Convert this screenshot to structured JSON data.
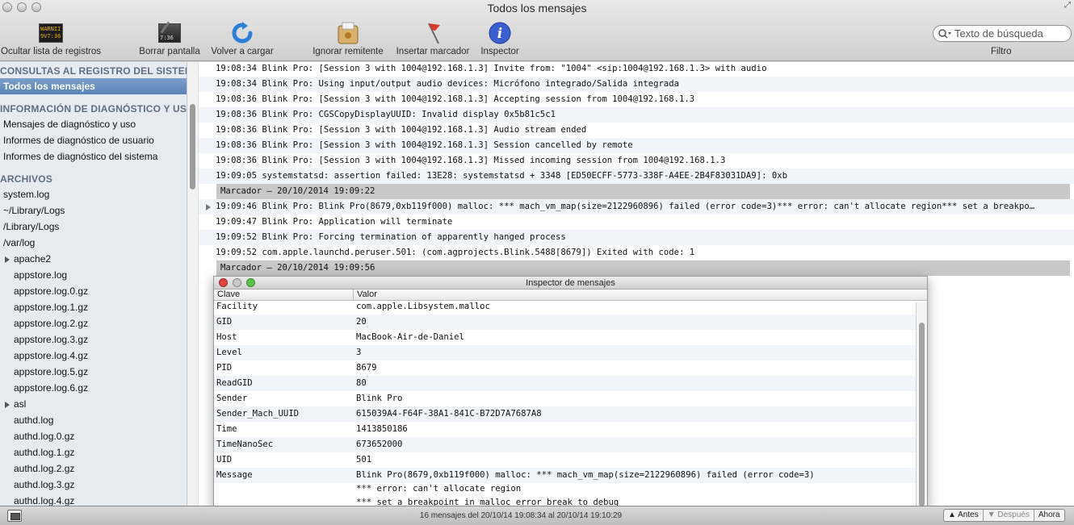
{
  "window": {
    "title": "Todos los mensajes"
  },
  "toolbar": {
    "items": [
      {
        "label": "Ocultar lista de registros",
        "icon": "console-icon",
        "icon_text": "WARNII\n9V7:36"
      },
      {
        "label": "Borrar pantalla",
        "icon": "clear-icon",
        "icon_text": "7:36"
      },
      {
        "label": "Volver a cargar",
        "icon": "reload-icon"
      },
      {
        "label": "Ignorar remitente",
        "icon": "ignore-icon"
      },
      {
        "label": "Insertar marcador",
        "icon": "marker-flag-icon"
      },
      {
        "label": "Inspector",
        "icon": "info-icon"
      }
    ],
    "search_placeholder": "Texto de búsqueda",
    "filter_label": "Filtro"
  },
  "sidebar": {
    "section1": "CONSULTAS AL REGISTRO DEL SISTEMA",
    "all_messages": "Todos los mensajes",
    "section2": "INFORMACIÓN DE DIAGNÓSTICO Y USO",
    "diag_items": [
      "Mensajes de diagnóstico y uso",
      "Informes de diagnóstico de usuario",
      "Informes de diagnóstico del sistema"
    ],
    "section3": "ARCHIVOS",
    "files": [
      {
        "label": "system.log",
        "indent": 0
      },
      {
        "label": "~/Library/Logs",
        "indent": 0
      },
      {
        "label": "/Library/Logs",
        "indent": 0
      },
      {
        "label": "/var/log",
        "indent": 0
      },
      {
        "label": "apache2",
        "indent": 1,
        "folder": true
      },
      {
        "label": "appstore.log",
        "indent": 2
      },
      {
        "label": "appstore.log.0.gz",
        "indent": 2
      },
      {
        "label": "appstore.log.1.gz",
        "indent": 2
      },
      {
        "label": "appstore.log.2.gz",
        "indent": 2
      },
      {
        "label": "appstore.log.3.gz",
        "indent": 2
      },
      {
        "label": "appstore.log.4.gz",
        "indent": 2
      },
      {
        "label": "appstore.log.5.gz",
        "indent": 2
      },
      {
        "label": "appstore.log.6.gz",
        "indent": 2
      },
      {
        "label": "asl",
        "indent": 1,
        "folder": true
      },
      {
        "label": "authd.log",
        "indent": 2
      },
      {
        "label": "authd.log.0.gz",
        "indent": 2
      },
      {
        "label": "authd.log.1.gz",
        "indent": 2
      },
      {
        "label": "authd.log.2.gz",
        "indent": 2
      },
      {
        "label": "authd.log.3.gz",
        "indent": 2
      },
      {
        "label": "authd.log.4.gz",
        "indent": 2
      }
    ]
  },
  "log": [
    {
      "text": "19:08:34 Blink Pro: [Session 3 with 1004@192.168.1.3] Invite from: \"1004\" <sip:1004@192.168.1.3> with audio"
    },
    {
      "text": "19:08:34 Blink Pro: Using input/output audio devices: Micrófono integrado/Salida integrada"
    },
    {
      "text": "19:08:36 Blink Pro: [Session 3 with 1004@192.168.1.3] Accepting session from 1004@192.168.1.3"
    },
    {
      "text": "19:08:36 Blink Pro: CGSCopyDisplayUUID: Invalid display 0x5b81c5c1"
    },
    {
      "text": "19:08:36 Blink Pro: [Session 3 with 1004@192.168.1.3] Audio stream ended"
    },
    {
      "text": "19:08:36 Blink Pro: [Session 3 with 1004@192.168.1.3] Session cancelled by remote"
    },
    {
      "text": "19:08:36 Blink Pro: [Session 3 with 1004@192.168.1.3] Missed incoming session from 1004@192.168.1.3"
    },
    {
      "text": "19:09:05 systemstatsd: assertion failed: 13E28: systemstatsd + 3348 [ED50ECFF-5773-338F-A4EE-2B4F83031DA9]: 0xb"
    },
    {
      "text": "Marcador – 20/10/2014 19:09:22",
      "marker": true
    },
    {
      "text": "19:09:46 Blink Pro: Blink Pro(8679,0xb119f000) malloc: *** mach_vm_map(size=2122960896) failed (error code=3)*** error: can't allocate region*** set a breakpo…",
      "expandable": true
    },
    {
      "text": "19:09:47 Blink Pro: Application will terminate"
    },
    {
      "text": "19:09:52 Blink Pro: Forcing termination of apparently hanged process"
    },
    {
      "text": "19:09:52 com.apple.launchd.peruser.501: (com.agprojects.Blink.5488[8679]) Exited with code: 1"
    },
    {
      "text": "Marcador – 20/10/2014 19:09:56",
      "marker": true
    }
  ],
  "inspector": {
    "title": "Inspector de mensajes",
    "col_key": "Clave",
    "col_value": "Valor",
    "rows": [
      {
        "k": "Facility",
        "v": "com.apple.Libsystem.malloc"
      },
      {
        "k": "GID",
        "v": "20"
      },
      {
        "k": "Host",
        "v": "MacBook-Air-de-Daniel"
      },
      {
        "k": "Level",
        "v": "3"
      },
      {
        "k": "PID",
        "v": "8679"
      },
      {
        "k": "ReadGID",
        "v": "80"
      },
      {
        "k": "Sender",
        "v": "Blink Pro"
      },
      {
        "k": "Sender_Mach_UUID",
        "v": "615039A4-F64F-38A1-841C-B72D7A7687A8"
      },
      {
        "k": "Time",
        "v": "1413850186"
      },
      {
        "k": "TimeNanoSec",
        "v": "673652000"
      },
      {
        "k": "UID",
        "v": "501"
      },
      {
        "k": "Message",
        "v": "Blink Pro(8679,0xb119f000) malloc: *** mach_vm_map(size=2122960896) failed (error code=3)"
      }
    ],
    "message_extra": [
      "*** error: can't allocate region",
      "*** set a breakpoint in malloc_error_break to debug"
    ]
  },
  "status": {
    "text": "16 mensajes del 20/10/14 19:08:34 al 20/10/14 19:10:29",
    "before": "Antes",
    "after": "Después",
    "now": "Ahora"
  },
  "colors": {
    "selection": "#5b83b7",
    "marker": "#c8c8c8",
    "sidebar_bg": "#e6ebf2"
  }
}
